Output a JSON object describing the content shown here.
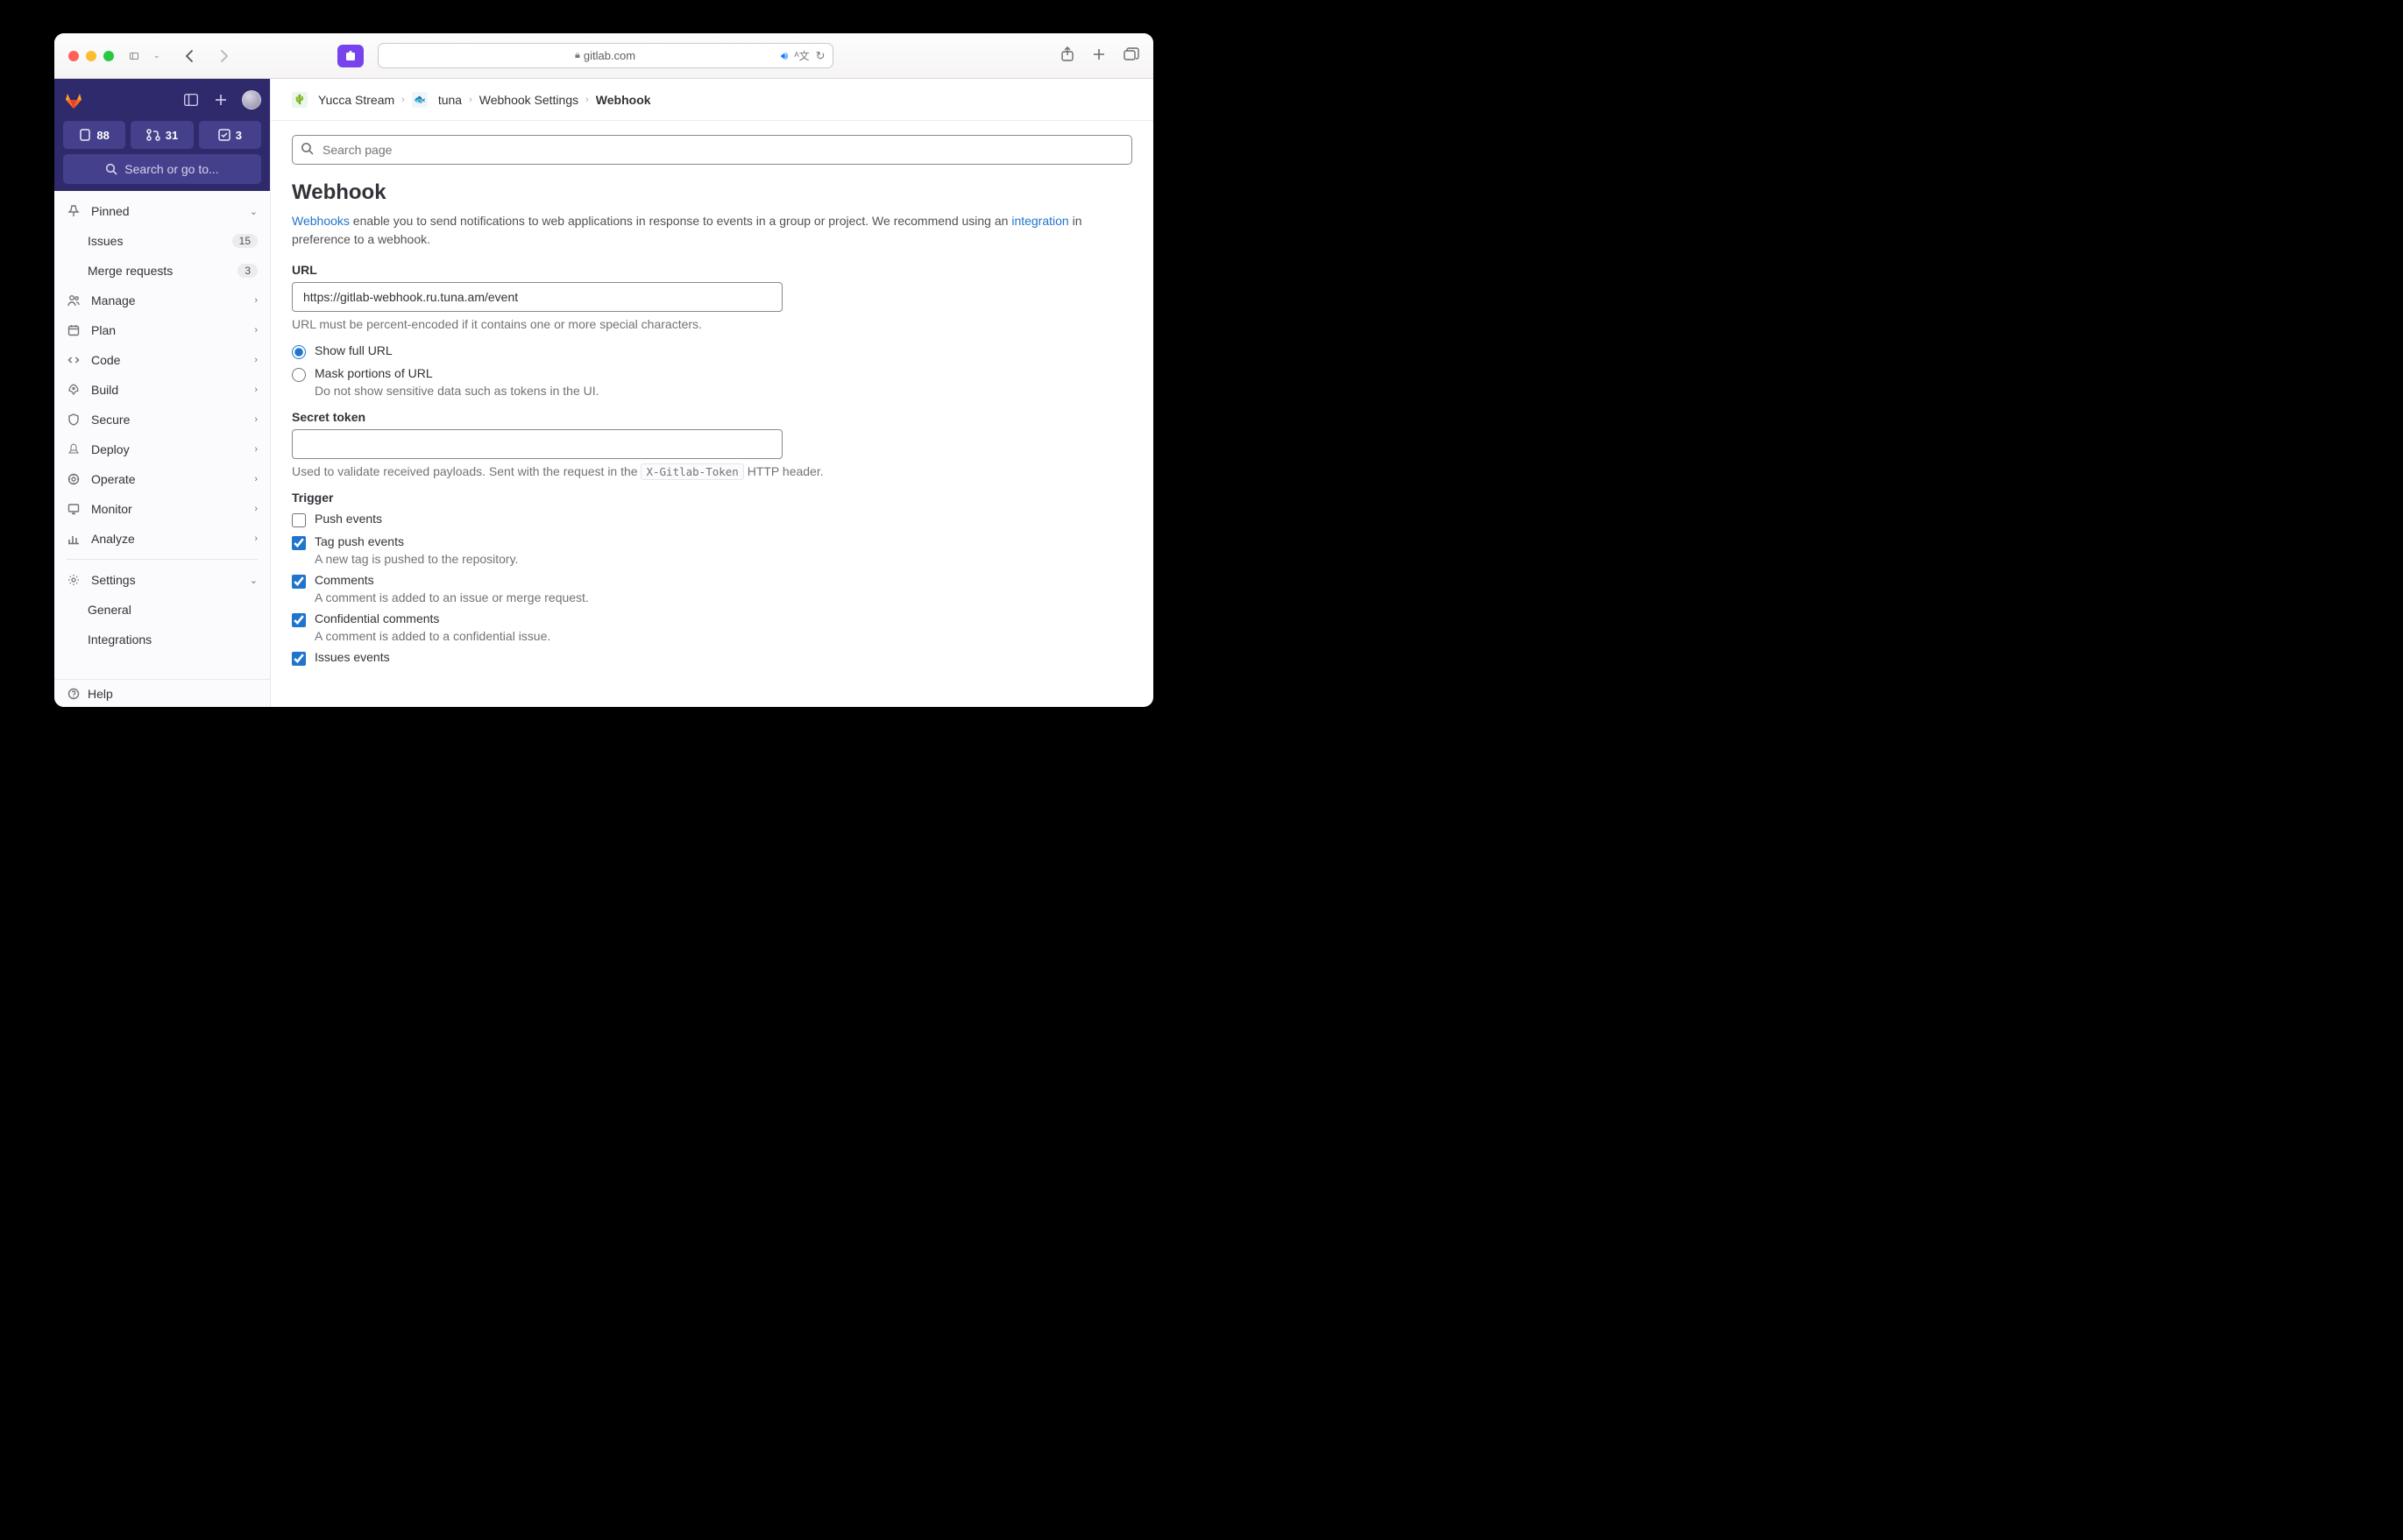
{
  "browser": {
    "url_display": "gitlab.com"
  },
  "sidebar": {
    "counters": {
      "issues": "88",
      "mrs": "31",
      "todos": "3"
    },
    "search_placeholder": "Search or go to...",
    "pinned_label": "Pinned",
    "pinned": {
      "issues": {
        "label": "Issues",
        "count": "15"
      },
      "mrs": {
        "label": "Merge requests",
        "count": "3"
      }
    },
    "nav": {
      "manage": "Manage",
      "plan": "Plan",
      "code": "Code",
      "build": "Build",
      "secure": "Secure",
      "deploy": "Deploy",
      "operate": "Operate",
      "monitor": "Monitor",
      "analyze": "Analyze",
      "settings": "Settings",
      "general": "General",
      "integrations": "Integrations"
    },
    "help": "Help"
  },
  "breadcrumbs": {
    "group": "Yucca Stream",
    "project": "tuna",
    "section": "Webhook Settings",
    "current": "Webhook"
  },
  "page": {
    "search_placeholder": "Search page",
    "title": "Webhook",
    "intro": {
      "link1": "Webhooks",
      "text1": " enable you to send notifications to web applications in response to events in a group or project. We recommend using an ",
      "link2": "integration",
      "text2": " in preference to a webhook."
    },
    "url": {
      "label": "URL",
      "value": "https://gitlab-webhook.ru.tuna.am/event",
      "help": "URL must be percent-encoded if it contains one or more special characters."
    },
    "url_mask": {
      "show": "Show full URL",
      "mask": "Mask portions of URL",
      "mask_help": "Do not show sensitive data such as tokens in the UI."
    },
    "secret": {
      "label": "Secret token",
      "help_pre": "Used to validate received payloads. Sent with the request in the ",
      "header": "X-Gitlab-Token",
      "help_post": " HTTP header."
    },
    "trigger": {
      "label": "Trigger",
      "push": "Push events",
      "tag": {
        "label": "Tag push events",
        "help": "A new tag is pushed to the repository."
      },
      "comments": {
        "label": "Comments",
        "help": "A comment is added to an issue or merge request."
      },
      "conf": {
        "label": "Confidential comments",
        "help": "A comment is added to a confidential issue."
      },
      "issues": {
        "label": "Issues events"
      }
    }
  }
}
